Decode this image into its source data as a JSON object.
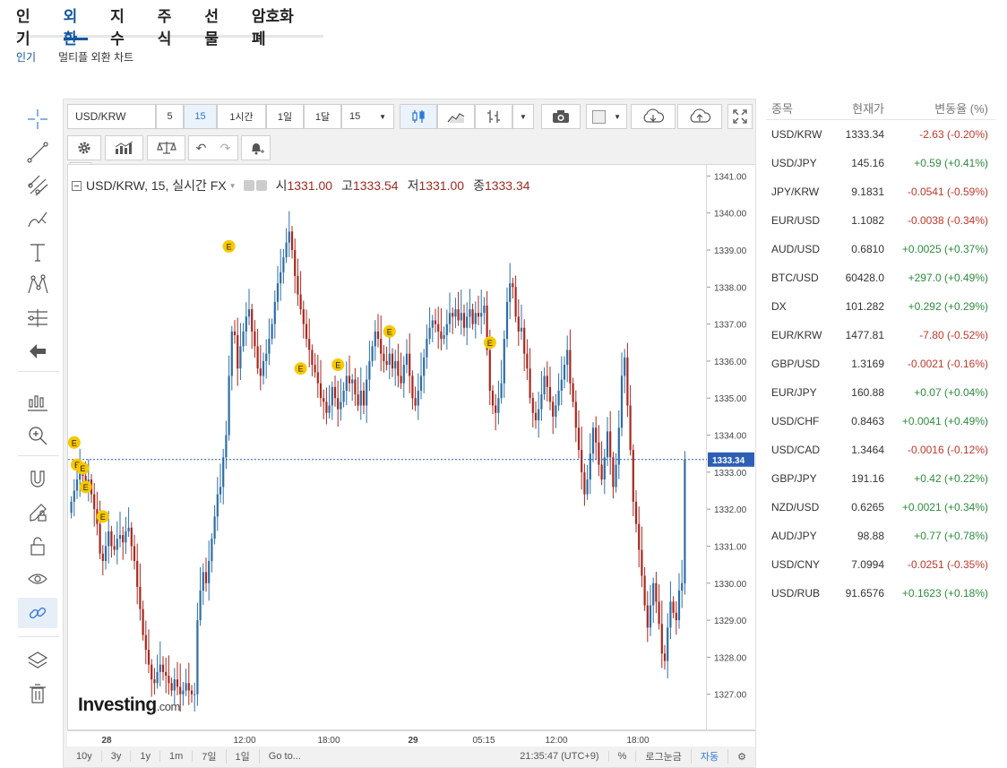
{
  "nav": {
    "tabs": [
      "인기",
      "외환",
      "지수",
      "주식",
      "선물",
      "암호화폐"
    ],
    "active": 1
  },
  "subnav": {
    "items": [
      "인기",
      "멀티플 외환 차트"
    ],
    "active": 0
  },
  "toolbar": {
    "symbol": "USD/KRW",
    "intervals": [
      "5",
      "15",
      "1시간",
      "1일",
      "1달"
    ],
    "interval_select": "15",
    "active_interval": "15"
  },
  "legend": {
    "title": "USD/KRW, 15, 실시간 FX",
    "open_label": "시",
    "open": "1331.00",
    "high_label": "고",
    "high": "1333.54",
    "low_label": "저",
    "low": "1331.00",
    "close_label": "종",
    "close": "1333.34"
  },
  "logo": {
    "brand": "Investing",
    "suffix": ".com"
  },
  "bottom_bar": {
    "ranges": [
      "10y",
      "3y",
      "1y",
      "1m",
      "7일",
      "1일"
    ],
    "goto": "Go to...",
    "time": "21:35:47 (UTC+9)",
    "percent": "%",
    "log": "로그눈금",
    "auto": "자동"
  },
  "chart_data": {
    "type": "candlestick",
    "title": "USD/KRW, 15, 실시간 FX",
    "yticks": [
      "1341.00",
      "1340.00",
      "1339.00",
      "1338.00",
      "1337.00",
      "1336.00",
      "1335.00",
      "1334.00",
      "1333.00",
      "1332.00",
      "1331.00",
      "1330.00",
      "1329.00",
      "1328.00",
      "1327.00"
    ],
    "ylim": [
      1326.0,
      1341.3
    ],
    "xticks": [
      "28",
      "12:00",
      "18:00",
      "29",
      "05:15",
      "12:00",
      "18:00"
    ],
    "last_price": "1333.34",
    "up_color": "#2e6ea6",
    "down_color": "#a8281f",
    "closes": [
      1332.2,
      1332.5,
      1332.8,
      1333.0,
      1332.9,
      1332.6,
      1332.8,
      1332.4,
      1332.0,
      1331.6,
      1330.8,
      1330.6,
      1331.0,
      1331.4,
      1331.0,
      1330.9,
      1331.2,
      1331.3,
      1331.1,
      1331.4,
      1331.5,
      1331.0,
      1330.6,
      1329.9,
      1329.3,
      1328.6,
      1328.2,
      1327.8,
      1327.4,
      1327.3,
      1327.6,
      1327.8,
      1327.6,
      1327.5,
      1327.3,
      1327.1,
      1327.4,
      1327.2,
      1327.0,
      1327.1,
      1327.3,
      1327.1,
      1327.0,
      1327.0,
      1329.0,
      1329.8,
      1330.3,
      1330.0,
      1330.6,
      1331.2,
      1331.8,
      1332.4,
      1332.6,
      1333.4,
      1334.0,
      1335.6,
      1336.8,
      1336.7,
      1335.8,
      1336.4,
      1336.8,
      1337.2,
      1337.4,
      1336.8,
      1336.4,
      1335.8,
      1335.6,
      1336.0,
      1336.2,
      1336.6,
      1337.0,
      1337.6,
      1338.1,
      1338.4,
      1338.8,
      1339.2,
      1339.5,
      1339.0,
      1338.3,
      1337.8,
      1337.4,
      1337.0,
      1336.6,
      1336.3,
      1335.9,
      1335.7,
      1335.4,
      1335.0,
      1334.9,
      1334.6,
      1334.8,
      1335.3,
      1335.0,
      1334.7,
      1334.9,
      1335.2,
      1335.6,
      1335.4,
      1335.5,
      1335.1,
      1334.8,
      1335.2,
      1334.8,
      1335.5,
      1336.0,
      1336.4,
      1336.8,
      1336.6,
      1336.2,
      1336.0,
      1335.9,
      1336.2,
      1335.8,
      1336.0,
      1335.6,
      1335.4,
      1335.9,
      1336.2,
      1335.6,
      1335.0,
      1334.8,
      1335.2,
      1335.6,
      1336.1,
      1336.6,
      1336.9,
      1337.1,
      1337.0,
      1336.8,
      1336.6,
      1336.7,
      1337.0,
      1337.3,
      1337.2,
      1337.4,
      1337.1,
      1337.3,
      1336.9,
      1337.2,
      1337.4,
      1337.0,
      1337.3,
      1337.2,
      1337.3,
      1337.5,
      1336.3,
      1335.2,
      1334.8,
      1334.6,
      1335.0,
      1335.4,
      1336.6,
      1337.6,
      1338.1,
      1338.0,
      1337.2,
      1336.8,
      1336.9,
      1336.2,
      1335.8,
      1335.0,
      1334.6,
      1334.4,
      1334.7,
      1335.1,
      1335.6,
      1335.3,
      1334.9,
      1334.5,
      1334.8,
      1335.2,
      1335.5,
      1335.9,
      1336.3,
      1335.4,
      1334.9,
      1334.2,
      1333.6,
      1333.0,
      1332.4,
      1332.8,
      1333.5,
      1334.2,
      1333.8,
      1333.2,
      1332.8,
      1333.4,
      1334.1,
      1333.4,
      1332.6,
      1333.2,
      1334.2,
      1335.6,
      1336.1,
      1334.8,
      1333.6,
      1332.2,
      1331.6,
      1330.9,
      1330.2,
      1329.4,
      1328.8,
      1329.4,
      1330.0,
      1329.5,
      1328.9,
      1328.1,
      1327.9,
      1328.8,
      1329.5,
      1329.2,
      1329.0,
      1329.8,
      1330.0,
      1333.34
    ],
    "earnings_markers": [
      [
        1,
        1333.8
      ],
      [
        2,
        1333.2
      ],
      [
        4,
        1333.1
      ],
      [
        5,
        1332.6
      ],
      [
        11,
        1331.8
      ],
      [
        55,
        1339.1
      ],
      [
        80,
        1335.8
      ],
      [
        93,
        1335.9
      ],
      [
        111,
        1336.8
      ],
      [
        146,
        1336.5
      ]
    ]
  },
  "quotes": {
    "headers": [
      "종목",
      "현재가",
      "변동율 (%)"
    ],
    "rows": [
      {
        "name": "USD/KRW",
        "price": "1333.34",
        "change": "-2.63 (-0.20%)",
        "dir": "neg"
      },
      {
        "name": "USD/JPY",
        "price": "145.16",
        "change": "+0.59 (+0.41%)",
        "dir": "pos"
      },
      {
        "name": "JPY/KRW",
        "price": "9.1831",
        "change": "-0.0541 (-0.59%)",
        "dir": "neg"
      },
      {
        "name": "EUR/USD",
        "price": "1.1082",
        "change": "-0.0038 (-0.34%)",
        "dir": "neg"
      },
      {
        "name": "AUD/USD",
        "price": "0.6810",
        "change": "+0.0025 (+0.37%)",
        "dir": "pos"
      },
      {
        "name": "BTC/USD",
        "price": "60428.0",
        "change": "+297.0 (+0.49%)",
        "dir": "pos"
      },
      {
        "name": "DX",
        "price": "101.282",
        "change": "+0.292 (+0.29%)",
        "dir": "pos"
      },
      {
        "name": "EUR/KRW",
        "price": "1477.81",
        "change": "-7.80 (-0.52%)",
        "dir": "neg"
      },
      {
        "name": "GBP/USD",
        "price": "1.3169",
        "change": "-0.0021 (-0.16%)",
        "dir": "neg"
      },
      {
        "name": "EUR/JPY",
        "price": "160.88",
        "change": "+0.07 (+0.04%)",
        "dir": "pos"
      },
      {
        "name": "USD/CHF",
        "price": "0.8463",
        "change": "+0.0041 (+0.49%)",
        "dir": "pos"
      },
      {
        "name": "USD/CAD",
        "price": "1.3464",
        "change": "-0.0016 (-0.12%)",
        "dir": "neg"
      },
      {
        "name": "GBP/JPY",
        "price": "191.16",
        "change": "+0.42 (+0.22%)",
        "dir": "pos"
      },
      {
        "name": "NZD/USD",
        "price": "0.6265",
        "change": "+0.0021 (+0.34%)",
        "dir": "pos"
      },
      {
        "name": "AUD/JPY",
        "price": "98.88",
        "change": "+0.77 (+0.78%)",
        "dir": "pos"
      },
      {
        "name": "USD/CNY",
        "price": "7.0994",
        "change": "-0.0251 (-0.35%)",
        "dir": "neg"
      },
      {
        "name": "USD/RUB",
        "price": "91.6576",
        "change": "+0.1623 (+0.18%)",
        "dir": "pos"
      }
    ]
  }
}
